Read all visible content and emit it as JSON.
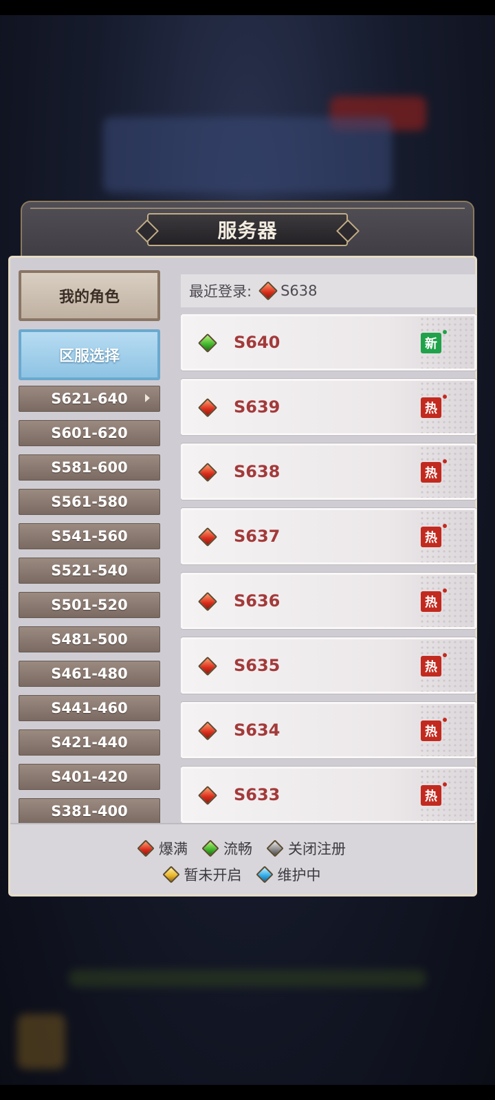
{
  "dialog": {
    "title": "服务器"
  },
  "tabs": {
    "my_roles": "我的角色",
    "server_select": "区服选择"
  },
  "ranges": [
    {
      "label": "S621-640",
      "selected": true
    },
    {
      "label": "S601-620"
    },
    {
      "label": "S581-600"
    },
    {
      "label": "S561-580"
    },
    {
      "label": "S541-560"
    },
    {
      "label": "S521-540"
    },
    {
      "label": "S501-520"
    },
    {
      "label": "S481-500"
    },
    {
      "label": "S461-480"
    },
    {
      "label": "S441-460"
    },
    {
      "label": "S421-440"
    },
    {
      "label": "S401-420"
    },
    {
      "label": "S381-400"
    }
  ],
  "recent": {
    "label": "最近登录:",
    "server": "S638",
    "status_icon": "gem-red"
  },
  "servers": [
    {
      "name": "S640",
      "status_icon": "gem-green",
      "badge": "新",
      "badge_type": "new"
    },
    {
      "name": "S639",
      "status_icon": "gem-red",
      "badge": "热",
      "badge_type": "hot"
    },
    {
      "name": "S638",
      "status_icon": "gem-red",
      "badge": "热",
      "badge_type": "hot"
    },
    {
      "name": "S637",
      "status_icon": "gem-red",
      "badge": "热",
      "badge_type": "hot"
    },
    {
      "name": "S636",
      "status_icon": "gem-red",
      "badge": "热",
      "badge_type": "hot"
    },
    {
      "name": "S635",
      "status_icon": "gem-red",
      "badge": "热",
      "badge_type": "hot"
    },
    {
      "name": "S634",
      "status_icon": "gem-red",
      "badge": "热",
      "badge_type": "hot"
    },
    {
      "name": "S633",
      "status_icon": "gem-red",
      "badge": "热",
      "badge_type": "hot"
    }
  ],
  "legend": {
    "full": "爆满",
    "smooth": "流畅",
    "closed_registration": "关闭注册",
    "not_open": "暂未开启",
    "maintenance": "维护中"
  },
  "colors": {
    "full": "#d92c1b",
    "smooth": "#3fb52a",
    "closed_registration": "#8a8a8a",
    "not_open": "#e7b52a",
    "maintenance": "#2ea9e6",
    "server_name": "#a33a3a",
    "badge_new": "#1fa24a",
    "badge_hot": "#c22a1f"
  }
}
